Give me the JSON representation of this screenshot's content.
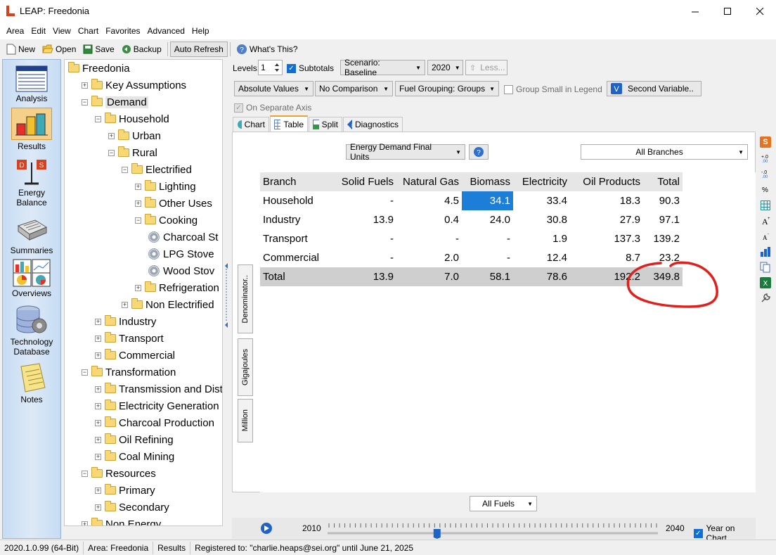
{
  "window": {
    "title": "LEAP: Freedonia"
  },
  "menu": [
    "Area",
    "Edit",
    "View",
    "Chart",
    "Favorites",
    "Advanced",
    "Help"
  ],
  "toolbar": {
    "new": "New",
    "open": "Open",
    "save": "Save",
    "backup": "Backup",
    "auto_refresh": "Auto Refresh",
    "whats_this": "What's This?"
  },
  "views": [
    {
      "label": "Analysis",
      "icon": "analysis-icon"
    },
    {
      "label": "Results",
      "icon": "results-icon"
    },
    {
      "label": "Energy Balance",
      "icon": "energy-balance-icon"
    },
    {
      "label": "Summaries",
      "icon": "summaries-icon"
    },
    {
      "label": "Overviews",
      "icon": "overviews-icon"
    },
    {
      "label": "Technology Database",
      "icon": "technology-database-icon"
    },
    {
      "label": "Notes",
      "icon": "notes-icon"
    }
  ],
  "tree": [
    {
      "label": "Freedonia",
      "kind": "folder",
      "expander": ""
    },
    {
      "label": "Key Assumptions",
      "kind": "folder",
      "expander": "+"
    },
    {
      "label": "Demand",
      "kind": "folder",
      "expander": "-",
      "selected": true
    },
    {
      "label": "Household",
      "kind": "folder",
      "expander": "-"
    },
    {
      "label": "Urban",
      "kind": "folder",
      "expander": "+"
    },
    {
      "label": "Rural",
      "kind": "folder",
      "expander": "-"
    },
    {
      "label": "Electrified",
      "kind": "folder",
      "expander": "-"
    },
    {
      "label": "Lighting",
      "kind": "folder",
      "expander": "+"
    },
    {
      "label": "Other Uses",
      "kind": "folder",
      "expander": "+"
    },
    {
      "label": "Cooking",
      "kind": "folder",
      "expander": "-"
    },
    {
      "label": "Charcoal St",
      "kind": "tech",
      "expander": ""
    },
    {
      "label": "LPG Stove",
      "kind": "tech",
      "expander": ""
    },
    {
      "label": "Wood Stov",
      "kind": "tech",
      "expander": ""
    },
    {
      "label": "Refrigeration",
      "kind": "folder",
      "expander": "+"
    },
    {
      "label": "Non Electrified",
      "kind": "folder",
      "expander": "+"
    },
    {
      "label": "Industry",
      "kind": "folder",
      "expander": "+"
    },
    {
      "label": "Transport",
      "kind": "folder",
      "expander": "+"
    },
    {
      "label": "Commercial",
      "kind": "folder",
      "expander": "+"
    },
    {
      "label": "Transformation",
      "kind": "folder",
      "expander": "-"
    },
    {
      "label": "Transmission and Dist",
      "kind": "folder",
      "expander": "+"
    },
    {
      "label": "Electricity Generation",
      "kind": "folder",
      "expander": "+"
    },
    {
      "label": "Charcoal Production",
      "kind": "folder",
      "expander": "+"
    },
    {
      "label": "Oil Refining",
      "kind": "folder",
      "expander": "+"
    },
    {
      "label": "Coal Mining",
      "kind": "folder",
      "expander": "+"
    },
    {
      "label": "Resources",
      "kind": "folder",
      "expander": "-"
    },
    {
      "label": "Primary",
      "kind": "folder",
      "expander": "+"
    },
    {
      "label": "Secondary",
      "kind": "folder",
      "expander": "+"
    },
    {
      "label": "Non Energy",
      "kind": "folder",
      "expander": "+"
    }
  ],
  "controls": {
    "levels_label": "Levels:",
    "levels_value": "1",
    "subtotals_label": "Subtotals",
    "scenario": "Scenario: Baseline",
    "year": "2020",
    "less": "Less...",
    "value_mode": "Absolute Values",
    "comparison": "No Comparison",
    "fuel_grouping": "Fuel Grouping: Groups",
    "group_small_label": "Group Small in Legend",
    "second_variable": "Second Variable..",
    "separate_axis_label": "On Separate Axis"
  },
  "tabs": [
    "Chart",
    "Table",
    "Split",
    "Diagnostics"
  ],
  "active_tab": "Table",
  "variable": "Energy Demand Final Units",
  "branch_filter": "All Branches",
  "table": {
    "headers": [
      "Branch",
      "Solid Fuels",
      "Natural Gas",
      "Biomass",
      "Electricity",
      "Oil Products",
      "Total"
    ],
    "rows": [
      [
        "Household",
        "-",
        "4.5",
        "34.1",
        "33.4",
        "18.3",
        "90.3"
      ],
      [
        "Industry",
        "13.9",
        "0.4",
        "24.0",
        "30.8",
        "27.9",
        "97.1"
      ],
      [
        "Transport",
        "-",
        "-",
        "-",
        "1.9",
        "137.3",
        "139.2"
      ],
      [
        "Commercial",
        "-",
        "2.0",
        "-",
        "12.4",
        "8.7",
        "23.2"
      ]
    ],
    "total": [
      "Total",
      "13.9",
      "7.0",
      "58.1",
      "78.6",
      "192.2",
      "349.8"
    ]
  },
  "side_tabs": [
    "Denominator..",
    "Gigajoules",
    "Million"
  ],
  "fuels_filter": "All Fuels",
  "timeline": {
    "start": "2010",
    "end": "2040",
    "year_on_chart_label": "Year on Chart",
    "position": 0.33
  },
  "status": {
    "version": "2020.1.0.99 (64-Bit)",
    "area": "Area: Freedonia",
    "view": "Results",
    "registered": "Registered to: \"charlie.heaps@sei.org\" until June 21, 2025"
  },
  "annotation_color": "#e0201c",
  "highlight_color": "#1c7ed6"
}
